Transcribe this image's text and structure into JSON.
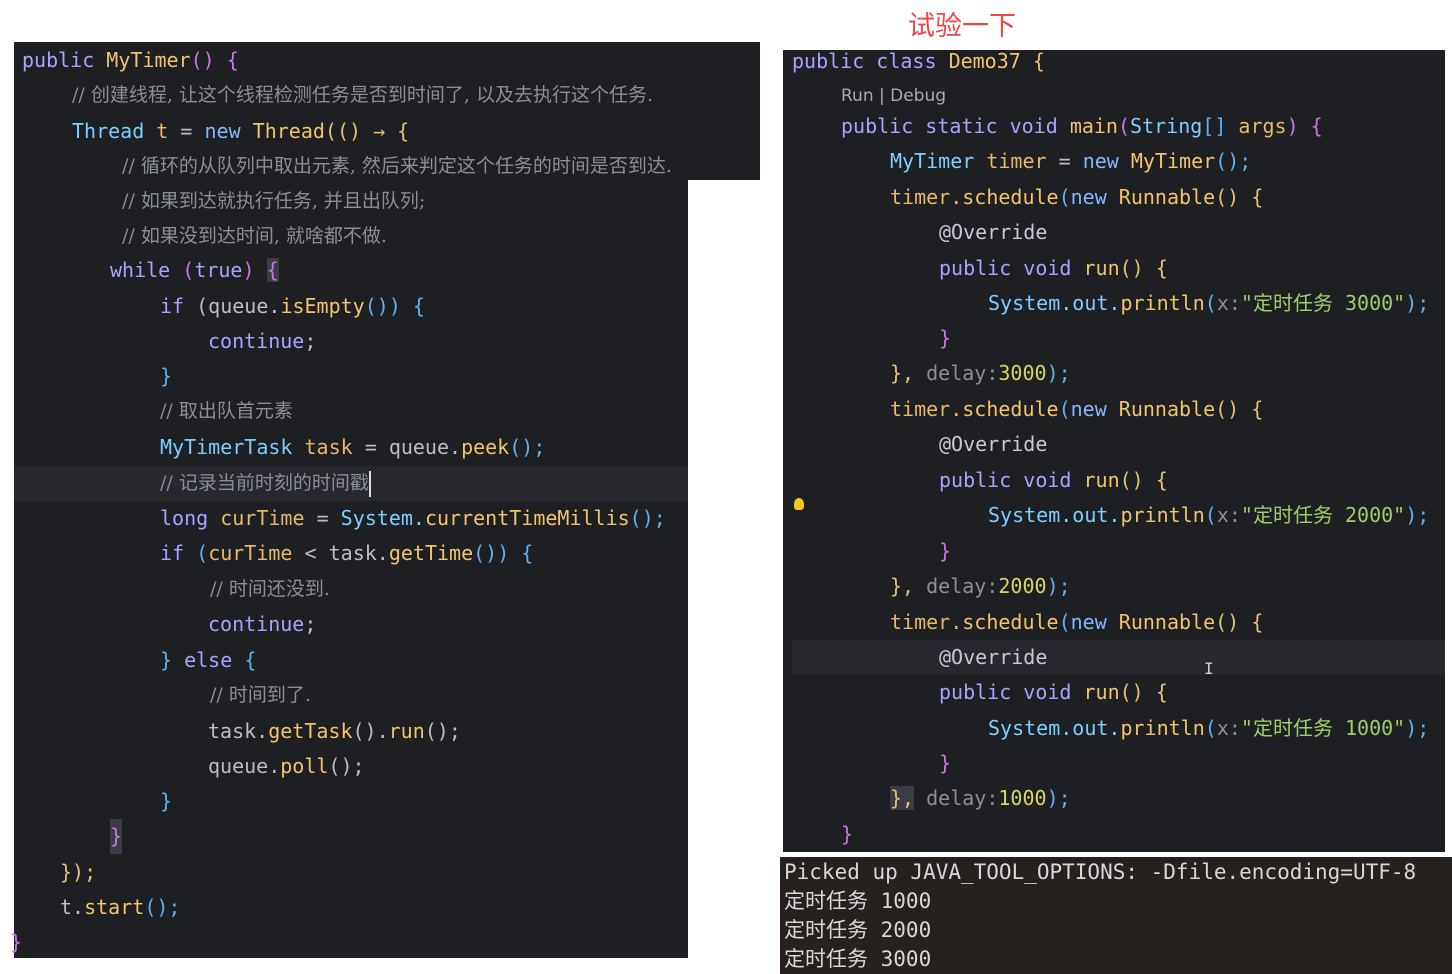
{
  "title": "试验一下",
  "left_code": {
    "l1": [
      "public",
      "MyTimer",
      "() {"
    ],
    "l2": "// 创建线程, 让这个线程检测任务是否到时间了, 以及去执行这个任务.",
    "l3": [
      "Thread",
      "t",
      "=",
      "new",
      "Thread",
      "(() → {"
    ],
    "l4": "// 循环的从队列中取出元素, 然后来判定这个任务的时间是否到达.",
    "l5": "// 如果到达就执行任务, 并且出队列;",
    "l6": "// 如果没到达时间, 就啥都不做.",
    "l7": [
      "while",
      "(",
      "true",
      ")",
      "{"
    ],
    "l8": [
      "if",
      "(queue.",
      "isEmpty",
      "()) {"
    ],
    "l9": [
      "continue",
      ";"
    ],
    "l10": "}",
    "l11": "// 取出队首元素",
    "l12": [
      "MyTimerTask",
      "task",
      "=",
      "queue.",
      "peek",
      "();"
    ],
    "l13": "// 记录当前时刻的时间戳",
    "l14": [
      "long",
      "curTime",
      "=",
      "System.",
      "currentTimeMillis",
      "();"
    ],
    "l15": [
      "if",
      "(",
      "curTime",
      "<",
      "task.",
      "getTime",
      "()) {"
    ],
    "l16": "// 时间还没到.",
    "l17": [
      "continue",
      ";"
    ],
    "l18": [
      "}",
      "else",
      "{"
    ],
    "l19": "// 时间到了.",
    "l20": [
      "task.",
      "getTask",
      "().",
      "run",
      "();"
    ],
    "l21": [
      "queue.",
      "poll",
      "();"
    ],
    "l22": "}",
    "l23": "}",
    "l24": "});",
    "l25": [
      "t.",
      "start",
      "();"
    ],
    "l26": "}"
  },
  "right_code": {
    "r1": [
      "public",
      "class",
      "Demo37",
      "{"
    ],
    "run_debug": "Run | Debug",
    "r2": [
      "public",
      "static",
      "void",
      "main",
      "(",
      "String",
      "[] ",
      "args",
      ") {"
    ],
    "r3": [
      "MyTimer",
      "timer",
      "=",
      "new",
      "MyTimer",
      "();"
    ],
    "blocks": [
      {
        "msg": "\"定时任务 3000\"",
        "delay": "3000"
      },
      {
        "msg": "\"定时任务 2000\"",
        "delay": "2000"
      },
      {
        "msg": "\"定时任务 1000\"",
        "delay": "1000"
      }
    ],
    "schedule": [
      "timer.",
      "schedule",
      "(",
      "new",
      "Runnable",
      "() {"
    ],
    "override": "@Override",
    "run_sig": [
      "public",
      "void",
      "run",
      "() {"
    ],
    "println": [
      "System.",
      "out.",
      "println",
      "(",
      "x:",
      ");"
    ],
    "close_brace": "}",
    "delay_prefix": "},",
    "delay_label": "delay:",
    "delay_suffix": ");",
    "end_brace": "}"
  },
  "terminal": {
    "lines": [
      "Picked up JAVA_TOOL_OPTIONS: -Dfile.encoding=UTF-8",
      "定时任务 1000",
      "定时任务 2000",
      "定时任务 3000"
    ]
  }
}
